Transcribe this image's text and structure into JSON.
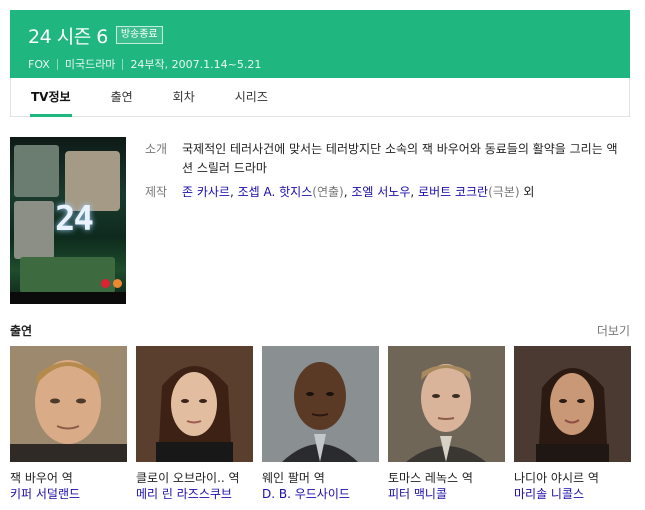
{
  "header": {
    "title": "24 시즌 6",
    "badge": "방송종료",
    "network": "FOX",
    "category": "미국드라마",
    "episodes_dates": "24부작, 2007.1.14~5.21",
    "accent_color": "#1fb67f"
  },
  "tabs": [
    {
      "label": "TV정보",
      "active": true
    },
    {
      "label": "출연",
      "active": false
    },
    {
      "label": "회차",
      "active": false
    },
    {
      "label": "시리즈",
      "active": false
    }
  ],
  "poster": {
    "number": "24"
  },
  "info": {
    "intro_label": "소개",
    "intro_text": "국제적인 테러사건에 맞서는 테러방지단 소속의 잭 바우어와 동료들의 활약을 그리는 액션 스릴러 드라마",
    "staff_label": "제작",
    "staff": [
      {
        "name": "존 카사르",
        "sep": ", "
      },
      {
        "name": "조셉 A. 핫지스",
        "role": "(연출)",
        "sep": ", "
      },
      {
        "name": "조엘 서노우",
        "sep": ", "
      },
      {
        "name": "로버트 코크란",
        "role": "(극본)",
        "sep": " 외"
      }
    ]
  },
  "cast_section": {
    "title": "출연",
    "more": "더보기"
  },
  "cast": [
    {
      "role": "잭 바우어 역",
      "actor": "키퍼 서덜랜드"
    },
    {
      "role": "클로이 오브라이.. 역",
      "actor": "메리 린 라즈스쿠브"
    },
    {
      "role": "웨인 팔머 역",
      "actor": "D. B. 우드사이드"
    },
    {
      "role": "토마스 레녹스 역",
      "actor": "피터 맥니콜"
    },
    {
      "role": "나디아 야시르 역",
      "actor": "마리솔 니콜스"
    }
  ]
}
